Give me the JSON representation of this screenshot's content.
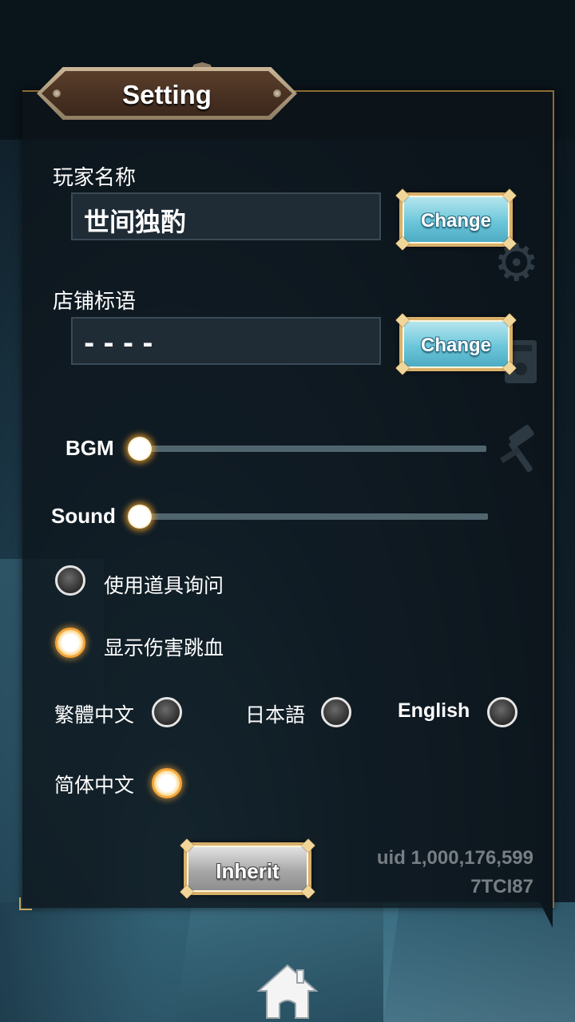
{
  "dialog": {
    "title": "Setting"
  },
  "player_name": {
    "label": "玩家名称",
    "value": "世间独酌",
    "change_label": "Change"
  },
  "shop_slogan": {
    "label": "店铺标语",
    "value": "- - - -",
    "change_label": "Change"
  },
  "audio": {
    "bgm_label": "BGM",
    "bgm_level": 0,
    "sound_label": "Sound",
    "sound_level": 0
  },
  "options": {
    "item_confirm_label": "使用道具询问",
    "item_confirm_on": false,
    "damage_numbers_label": "显示伤害跳血",
    "damage_numbers_on": true
  },
  "language": {
    "traditional": "繁體中文",
    "japanese": "日本語",
    "english": "English",
    "simplified": "简体中文",
    "selected": "简体中文"
  },
  "account": {
    "inherit_label": "Inherit",
    "uid": "uid 1,000,176,599",
    "code": "7TCI87"
  },
  "icons": [
    "gear-icon",
    "book-icon",
    "hammer-icon",
    "home-icon"
  ],
  "colors": {
    "accent_glow": "#f6a63a",
    "button_blue": "#6cc6da",
    "gold_frame": "#d9b06a"
  }
}
